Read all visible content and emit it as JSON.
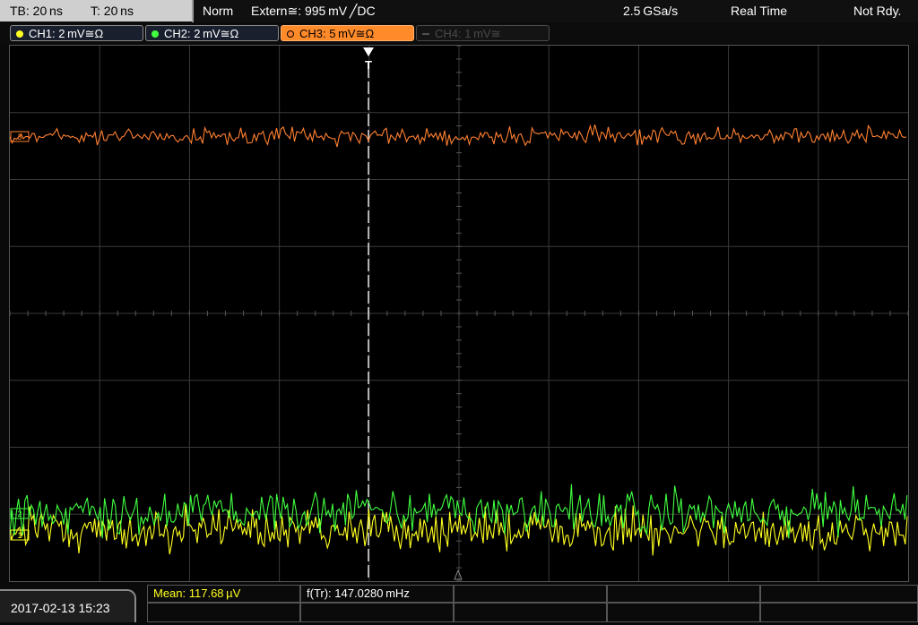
{
  "header": {
    "timebase": "TB: 20 ns",
    "trigger_time": "T: 20 ns",
    "mode": "Norm",
    "trigger_source": "Extern≅: 995 mV ╱DC",
    "sample_rate": "2.5 GSa/s",
    "acq_mode": "Real Time",
    "status": "Not Rdy."
  },
  "channels": [
    {
      "label": "CH1: 2 mV≅Ω",
      "color": "#ffff20",
      "state": "on"
    },
    {
      "label": "CH2: 2 mV≅Ω",
      "color": "#40ff40",
      "state": "on"
    },
    {
      "label": "CH3: 5 mV≅Ω",
      "color": "#ff8030",
      "state": "selected"
    },
    {
      "label": "CH4: 1 mV≅",
      "color": "#505050",
      "state": "off"
    }
  ],
  "markers": {
    "ch1": "1",
    "ch2": "2",
    "ch3": "3",
    "trigger": "T"
  },
  "footer": {
    "datetime": "2017-02-13 15:23",
    "meas_mean": "Mean: 117.68 µV",
    "meas_freq": "f(Tr): 147.0280 mHz"
  },
  "colors": {
    "ch1": "#ffff20",
    "ch2": "#40ff40",
    "ch3": "#ff8030",
    "grid": "#3a3a3a",
    "background": "#000000"
  }
}
